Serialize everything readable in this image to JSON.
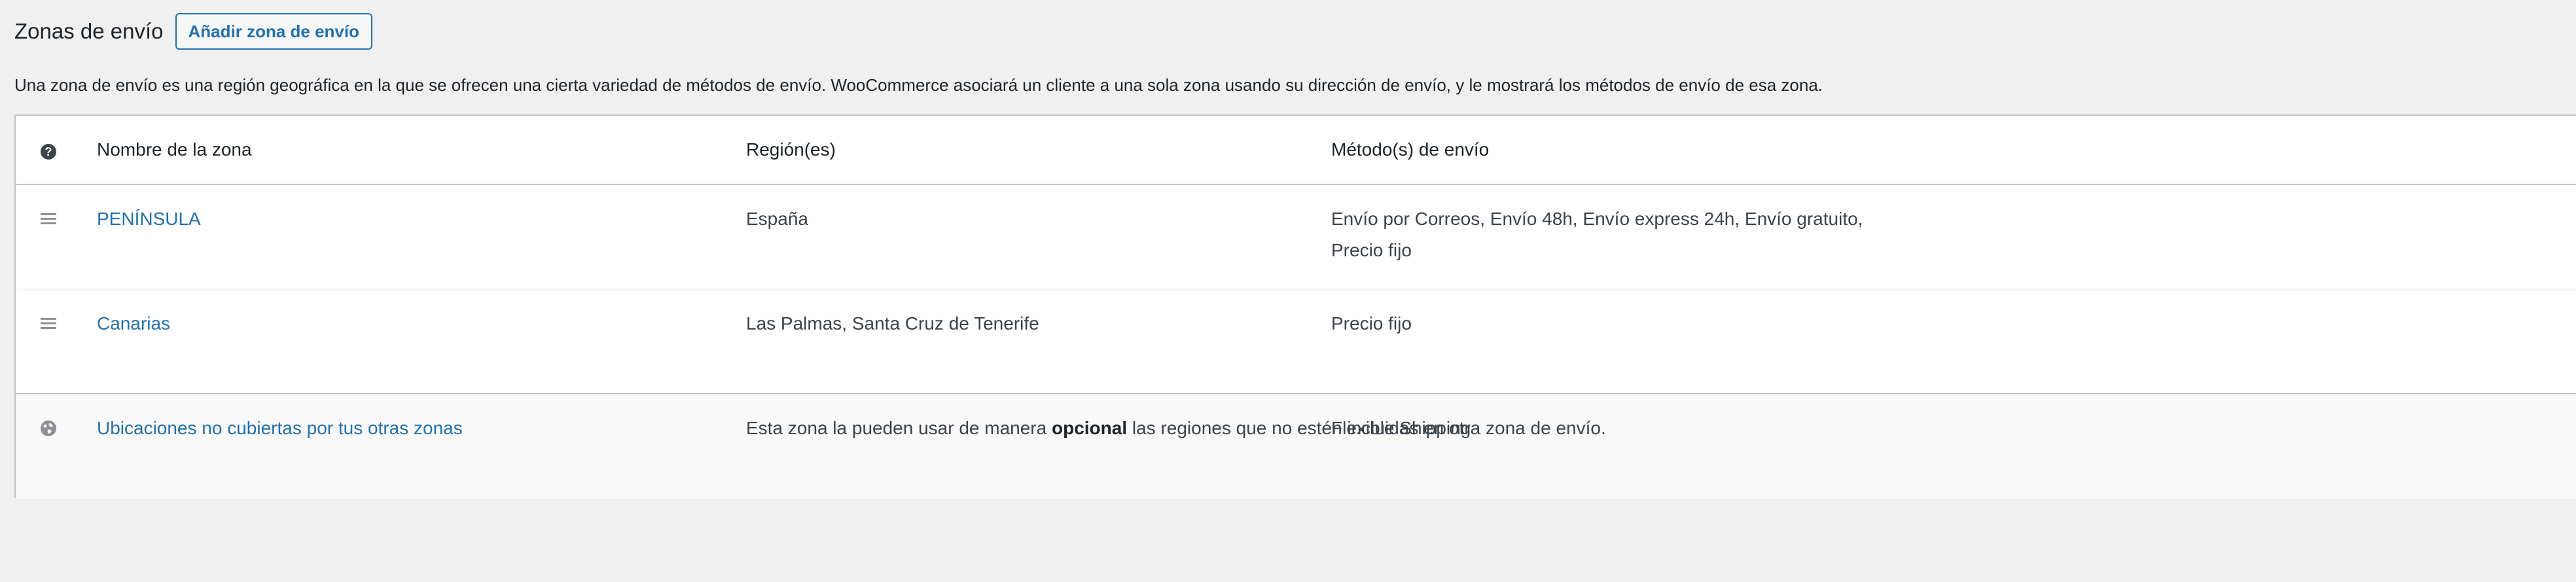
{
  "header": {
    "title": "Zonas de envío",
    "add_button": "Añadir zona de envío"
  },
  "intro": "Una zona de envío es una región geográfica en la que se ofrecen una cierta variedad de métodos de envío. WooCommerce asociará un cliente a una sola zona usando su dirección de envío, y le mostrará los métodos de envío de esa zona.",
  "table": {
    "columns": {
      "help": "?",
      "name": "Nombre de la zona",
      "regions": "Región(es)",
      "methods": "Método(s) de envío"
    },
    "rows": [
      {
        "name": "PENÍNSULA",
        "regions": "España",
        "methods_line1": "Envío por Correos, Envío 48h, Envío express 24h, Envío gratuito,",
        "methods_line2": "Precio fijo"
      },
      {
        "name": "Canarias",
        "regions": "Las Palmas, Santa Cruz de Tenerife",
        "methods_line1": "Precio fijo"
      }
    ],
    "fallback": {
      "name": "Ubicaciones no cubiertas por tus otras zonas",
      "regions_before": "Esta zona la pueden usar de manera ",
      "regions_bold": "opcional",
      "regions_after": " las regiones que no estén incluidas en otra zona de envío.",
      "methods": "Flexible Shipping"
    }
  },
  "icons": {
    "help": "help-circle-icon",
    "drag": "drag-handle-icon",
    "globe": "globe-icon"
  },
  "colors": {
    "link": "#2271b1",
    "background": "#f0f0f1",
    "border": "#c3c4c7"
  }
}
